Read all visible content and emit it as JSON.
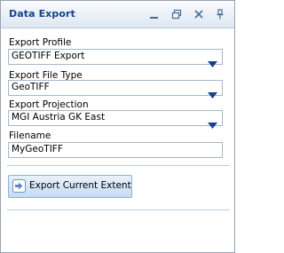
{
  "window": {
    "title": "Data Export",
    "controls": [
      {
        "name": "minimize-icon"
      },
      {
        "name": "restore-icon"
      },
      {
        "name": "close-icon"
      },
      {
        "name": "pin-icon"
      }
    ]
  },
  "form": {
    "profile": {
      "label": "Export Profile",
      "value": "GEOTIFF Export"
    },
    "file_type": {
      "label": "Export File Type",
      "value": "GeoTIFF"
    },
    "projection": {
      "label": "Export Projection",
      "value": "MGI Austria GK East"
    },
    "filename": {
      "label": "Filename",
      "value": "MyGeoTIFF"
    }
  },
  "actions": {
    "export_label": "Export Current Extent"
  },
  "colors": {
    "title_text": "#15428b",
    "arrow": "#15428b",
    "border": "#a8b7c9"
  }
}
